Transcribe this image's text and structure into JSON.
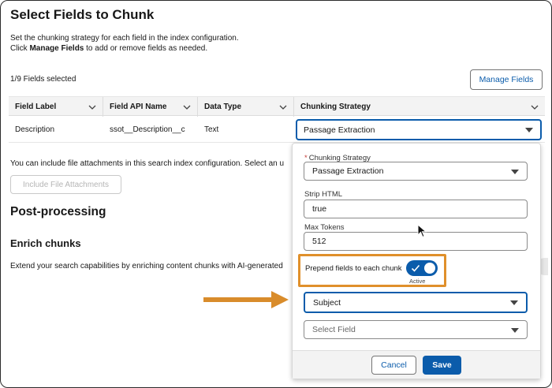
{
  "page": {
    "title": "Select Fields to Chunk",
    "description_line1": "Set the chunking strategy for each field in the index configuration.",
    "description_line2_pre": "Click ",
    "description_line2_bold": "Manage Fields",
    "description_line2_post": " to add or remove fields as needed.",
    "fields_selected": "1/9 Fields selected",
    "manage_fields_label": "Manage Fields"
  },
  "table": {
    "columns": [
      "Field Label",
      "Field API Name",
      "Data Type",
      "Chunking Strategy"
    ],
    "rows": [
      {
        "field_label": "Description",
        "api_name": "ssot__Description__c",
        "data_type": "Text",
        "chunking_strategy": "Passage Extraction"
      }
    ]
  },
  "attachments": {
    "text": "You can include file attachments in this search index configuration. Select an u",
    "button_label": "Include File Attachments"
  },
  "post_processing": {
    "heading": "Post-processing",
    "enrich_heading": "Enrich chunks",
    "enrich_text": "Extend your search capabilities by enriching content chunks with AI-generated"
  },
  "popover": {
    "strategy_label": "Chunking Strategy",
    "strategy_value": "Passage Extraction",
    "strip_html_label": "Strip HTML",
    "strip_html_value": "true",
    "max_tokens_label": "Max Tokens",
    "max_tokens_value": "512",
    "prepend_label": "Prepend fields to each chunk",
    "prepend_state": "Active",
    "field1_value": "Subject",
    "field2_placeholder": "Select Field",
    "cancel_label": "Cancel",
    "save_label": "Save"
  },
  "colors": {
    "brand": "#0b5cab",
    "highlight": "#e0902b",
    "arrow": "#d98c2b"
  }
}
